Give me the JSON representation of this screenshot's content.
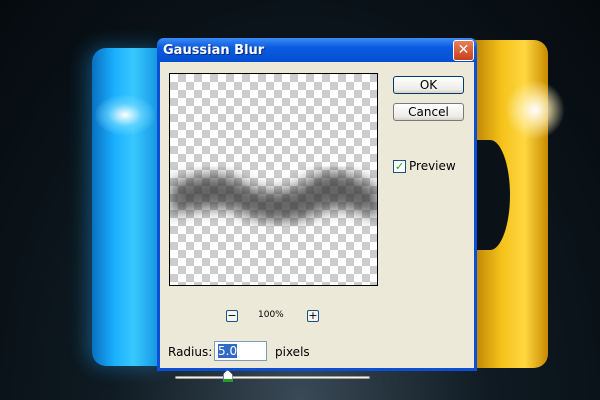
{
  "dialog": {
    "title": "Gaussian Blur",
    "close_label": "✕"
  },
  "buttons": {
    "ok": "OK",
    "cancel": "Cancel"
  },
  "preview": {
    "label": "Preview",
    "checked": true,
    "check_mark": "✓"
  },
  "zoom": {
    "minus": "−",
    "plus": "+",
    "level": "100%"
  },
  "radius": {
    "label": "Radius:",
    "value": "5.0",
    "unit": "pixels",
    "slider_fraction": 0.27
  }
}
